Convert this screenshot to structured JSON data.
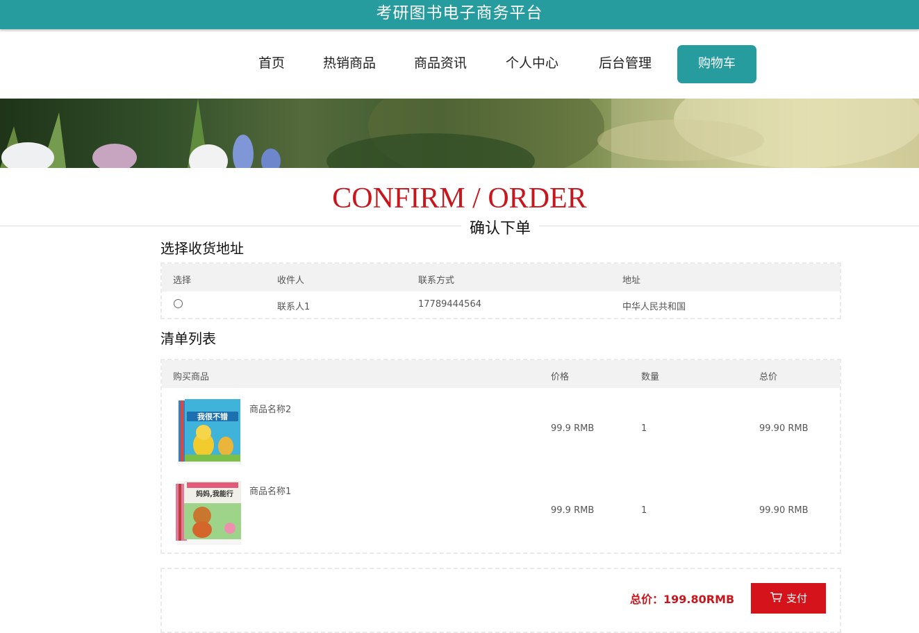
{
  "header": {
    "title": "考研图书电子商务平台"
  },
  "nav": {
    "items": [
      {
        "label": "首页"
      },
      {
        "label": "热销商品"
      },
      {
        "label": "商品资讯"
      },
      {
        "label": "个人中心"
      },
      {
        "label": "后台管理"
      },
      {
        "label": "购物车"
      }
    ],
    "active": "购物车"
  },
  "page": {
    "title_en": "CONFIRM / ORDER",
    "title_cn": "确认下单"
  },
  "address_section": {
    "title": "选择收货地址",
    "columns": [
      "选择",
      "收件人",
      "联系方式",
      "地址"
    ],
    "rows": [
      {
        "selected": false,
        "recipient": "联系人1",
        "phone": "17789444564",
        "address": "中华人民共和国"
      }
    ]
  },
  "items_section": {
    "title": "清单列表",
    "columns": [
      "购买商品",
      "价格",
      "数量",
      "总价"
    ],
    "rows": [
      {
        "name": "商品名称2",
        "price": "99.9 RMB",
        "qty": "1",
        "total": "99.90 RMB",
        "cover_text": "我很不错"
      },
      {
        "name": "商品名称1",
        "price": "99.9 RMB",
        "qty": "1",
        "total": "99.90 RMB",
        "cover_text": "妈妈,我能行"
      }
    ]
  },
  "footer": {
    "total_label": "总价：199.80RMB",
    "pay_label": "支付",
    "pay_icon": "cart-icon"
  },
  "colors": {
    "teal": "#279c9f",
    "red": "#c8161d",
    "button_red": "#d5131b"
  }
}
